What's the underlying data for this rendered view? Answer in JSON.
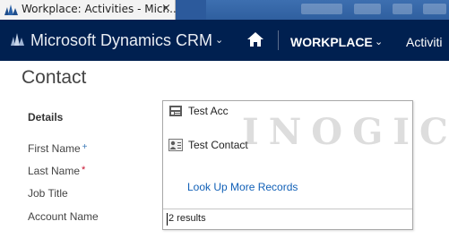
{
  "browser": {
    "tab_title": "Workplace: Activities - Micr...",
    "close_glyph": "×"
  },
  "navbar": {
    "brand": "Microsoft Dynamics CRM",
    "brand_chevron": "⌄",
    "workplace": "WORKPLACE",
    "workplace_chevron": "⌄",
    "next_item": "Activiti"
  },
  "form": {
    "entity_title": "Contact",
    "section_header": "Details",
    "fields": [
      {
        "label": "First Name",
        "marker": "+"
      },
      {
        "label": "Last Name",
        "marker": "*"
      },
      {
        "label": "Job Title",
        "marker": ""
      },
      {
        "label": "Account Name",
        "marker": ""
      }
    ]
  },
  "lookup": {
    "results": [
      {
        "label": "Test Acc",
        "icon": "account-icon"
      },
      {
        "label": "Test Contact",
        "icon": "contact-card-icon"
      }
    ],
    "look_up_more": "Look Up More Records",
    "results_count": "2 results"
  },
  "watermark": "INOGIC",
  "colors": {
    "navbar_bg": "#002050",
    "link": "#1160b7",
    "required": "#c7102e",
    "recommended": "#3b79b7"
  }
}
